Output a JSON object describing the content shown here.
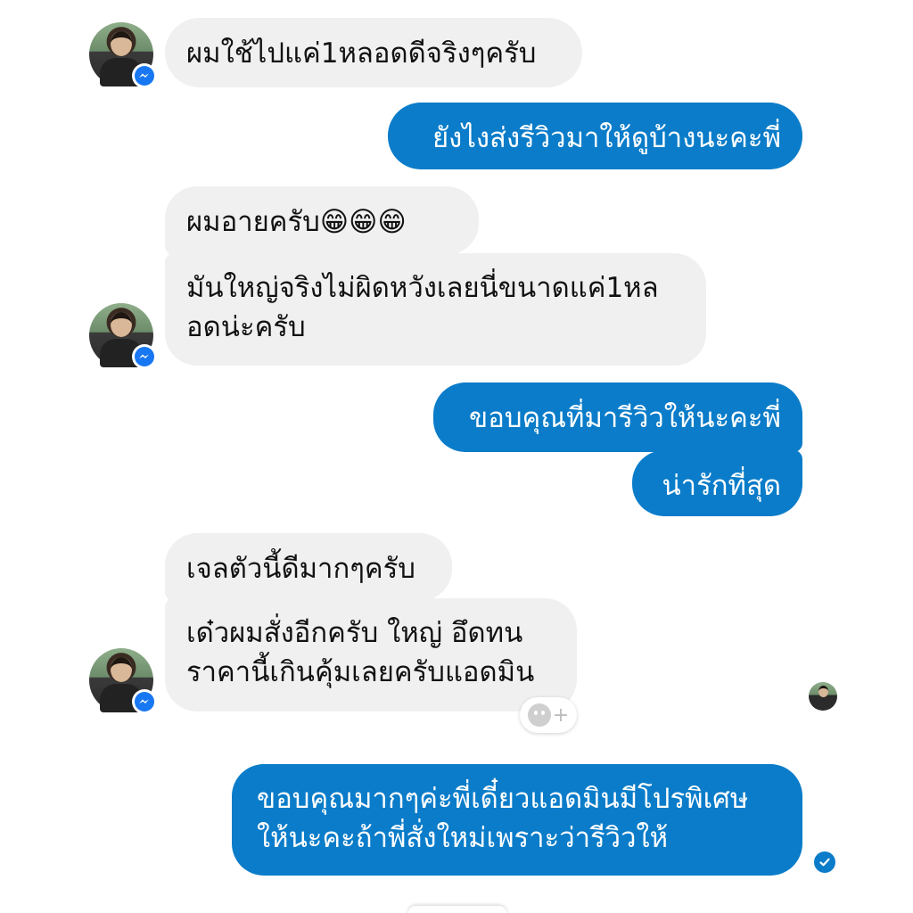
{
  "messages": [
    {
      "id": "m1",
      "side": "in",
      "text": "ผมใช้ไปแค่1หลอดดีจริงๆครับ"
    },
    {
      "id": "m2",
      "side": "out",
      "text": "ยังไงส่งรีวิวมาให้ดูบ้างนะคะพี่"
    },
    {
      "id": "m3",
      "side": "in",
      "text": "ผมอายครับ😁😁😁"
    },
    {
      "id": "m4",
      "side": "in",
      "lines": [
        "มันใหญ่จริงไม่ผิดหวังเลยนี่ขนาดแค่1หล",
        "อดน่ะครับ"
      ]
    },
    {
      "id": "m5",
      "side": "out",
      "text": "ขอบคุณที่มารีวิวให้นะคะพี่"
    },
    {
      "id": "m6",
      "side": "out",
      "text": "น่ารักที่สุด"
    },
    {
      "id": "m7",
      "side": "in",
      "text": "เจลตัวนี้ดีมากๆครับ"
    },
    {
      "id": "m8",
      "side": "in",
      "lines": [
        "เด๋วผมสั่งอีกครับ ใหญ่ อึดทน",
        "ราคานี้เกินคุ้มเลยครับแอดมิน"
      ]
    },
    {
      "id": "m9",
      "side": "out",
      "lines": [
        "ขอบคุณมากๆค่ะพี่เดี๋ยวแอดมินมีโปรพิเศษ",
        "ให้นะคะถ้าพี่สั่งใหม่เพราะว่ารีวิวให้"
      ]
    }
  ],
  "icons": {
    "messenger_badge": "messenger-icon",
    "react": "add-reaction-icon",
    "seen": "check-circle-icon"
  },
  "react_button": {
    "plus": "+"
  },
  "colors": {
    "outgoing": "#0a7cc9",
    "incoming": "#f1f0f0",
    "messenger_badge": "#1877f2"
  }
}
